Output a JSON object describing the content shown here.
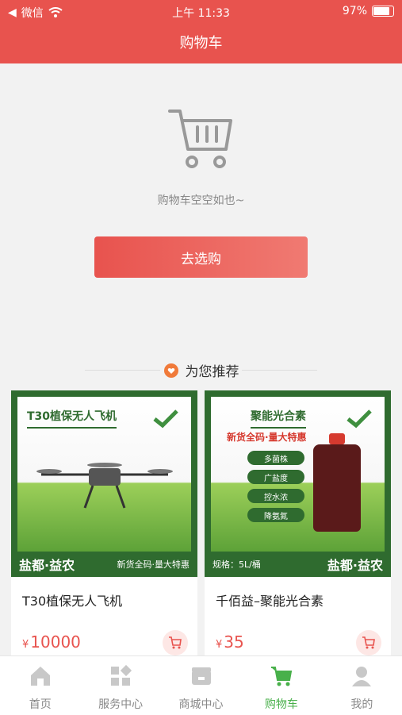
{
  "status": {
    "carrier": "微信",
    "time": "上午 11:33",
    "battery": "97%"
  },
  "header": {
    "title": "购物车"
  },
  "empty": {
    "message": "购物车空空如也~",
    "button": "去选购"
  },
  "recommend": {
    "title": "为您推荐"
  },
  "products": [
    {
      "image_title": "T30植保无人飞机",
      "image_brand": "盐都·益农",
      "image_slogan": "新货全码·量大特惠",
      "name": "T30植保无人飞机",
      "currency": "¥",
      "price": "10000"
    },
    {
      "image_title": "聚能光合素",
      "image_subtitle": "新货全码·量大特惠",
      "image_features": [
        "多菌株",
        "广盐度",
        "控水浓",
        "降氨氮"
      ],
      "image_spec": "规格：5L/桶",
      "image_brand": "盐都·益农",
      "name": "千佰益–聚能光合素",
      "currency": "¥",
      "price": "35"
    }
  ],
  "tabs": [
    {
      "label": "首页",
      "icon": "home-icon",
      "active": false
    },
    {
      "label": "服务中心",
      "icon": "service-icon",
      "active": false
    },
    {
      "label": "商城中心",
      "icon": "mall-icon",
      "active": false
    },
    {
      "label": "购物车",
      "icon": "cart-icon",
      "active": true
    },
    {
      "label": "我的",
      "icon": "profile-icon",
      "active": false
    }
  ],
  "colors": {
    "primary": "#e8534e",
    "tab_active": "#48b04a",
    "brand_green": "#2f6b2f"
  }
}
